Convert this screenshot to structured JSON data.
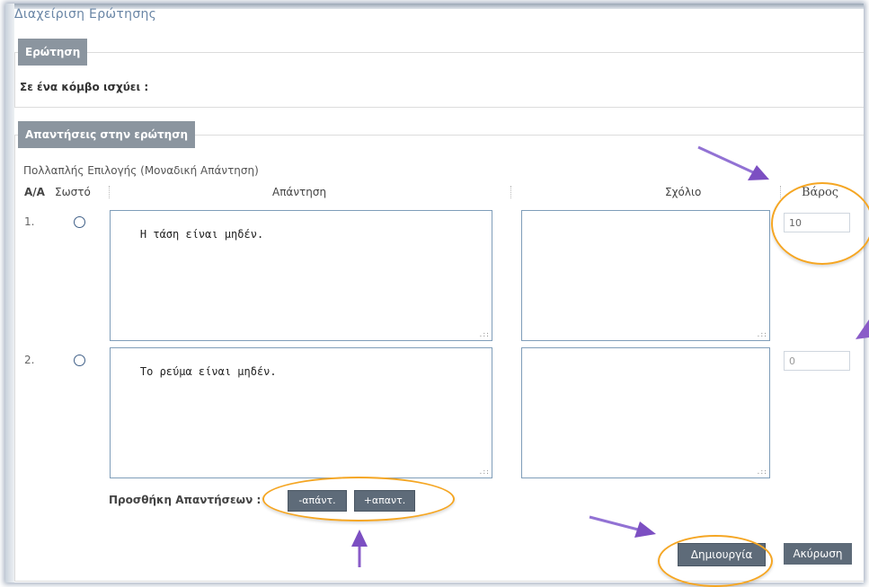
{
  "page": {
    "title": "Διαχείριση Ερώτησης"
  },
  "question": {
    "legend": "Ερώτηση",
    "text": "Σε ένα κόμβο ισχύει :"
  },
  "answers": {
    "legend": "Απαντήσεις στην ερώτηση",
    "type": "Πολλαπλής Επιλογής (Μοναδική Απάντηση)",
    "columns": {
      "aa": "Α/Α",
      "correct": "Σωστό",
      "answer": "Απάντηση",
      "comment": "Σχόλιο",
      "weight": "Βάρος"
    },
    "rows": [
      {
        "num": "1.",
        "answer": "Η τάση είναι μηδέν.",
        "comment": "",
        "weight": "10"
      },
      {
        "num": "2.",
        "answer": "Το ρεύμα είναι μηδέν.",
        "comment": "",
        "weight": "0"
      }
    ],
    "add_label": "Προσθήκη Απαντήσεων :",
    "minus_button": "-απάντ.",
    "plus_button": "+απαντ."
  },
  "actions": {
    "create": "Δημιουργία",
    "cancel": "Ακύρωση"
  },
  "annotation_colors": {
    "ellipse": "#f5a623",
    "arrow": "#8a5cc8"
  }
}
